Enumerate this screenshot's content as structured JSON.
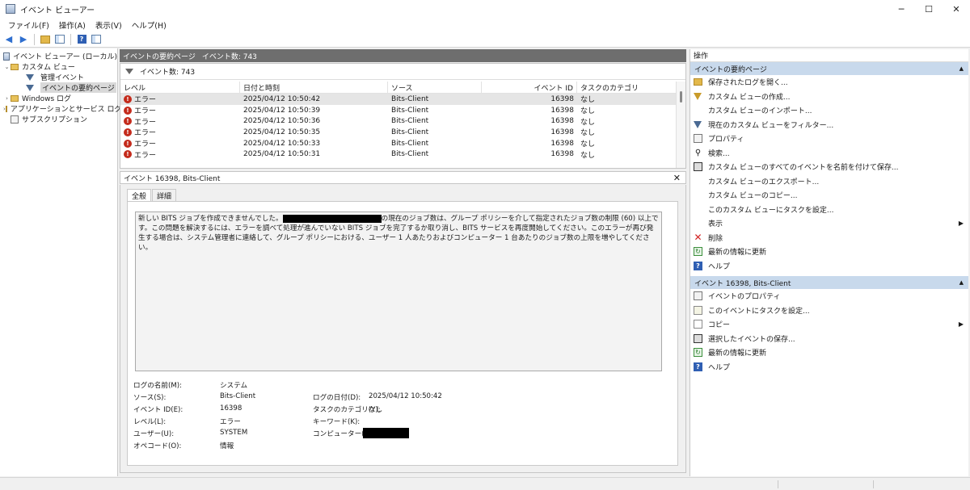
{
  "window": {
    "title": "イベント ビューアー",
    "controls": [
      "─",
      "☐",
      "✕"
    ]
  },
  "menu": [
    "ファイル(F)",
    "操作(A)",
    "表示(V)",
    "ヘルプ(H)"
  ],
  "tree": {
    "items": [
      {
        "label": "イベント ビューアー (ローカル)",
        "expander": "",
        "level": 0
      },
      {
        "label": "カスタム ビュー",
        "expander": "⌄",
        "level": 1
      },
      {
        "label": "管理イベント",
        "expander": "",
        "level": 2
      },
      {
        "label": "イベントの要約ページ",
        "expander": "",
        "level": 2
      },
      {
        "label": "Windows ログ",
        "expander": "›",
        "level": 1
      },
      {
        "label": "アプリケーションとサービス ログ",
        "expander": "›",
        "level": 1
      },
      {
        "label": "サブスクリプション",
        "expander": "",
        "level": 1
      }
    ]
  },
  "center": {
    "header_title": "イベントの要約ページ",
    "header_count": "イベント数: 743",
    "filter_text": "イベント数: 743",
    "columns": [
      "レベル",
      "日付と時刻",
      "ソース",
      "イベント ID",
      "タスクのカテゴリ"
    ],
    "rows": [
      {
        "level": "エラー",
        "datetime": "2025/04/12 10:50:42",
        "source": "Bits-Client",
        "id": "16398",
        "category": "なし"
      },
      {
        "level": "エラー",
        "datetime": "2025/04/12 10:50:39",
        "source": "Bits-Client",
        "id": "16398",
        "category": "なし"
      },
      {
        "level": "エラー",
        "datetime": "2025/04/12 10:50:36",
        "source": "Bits-Client",
        "id": "16398",
        "category": "なし"
      },
      {
        "level": "エラー",
        "datetime": "2025/04/12 10:50:35",
        "source": "Bits-Client",
        "id": "16398",
        "category": "なし"
      },
      {
        "level": "エラー",
        "datetime": "2025/04/12 10:50:33",
        "source": "Bits-Client",
        "id": "16398",
        "category": "なし"
      },
      {
        "level": "エラー",
        "datetime": "2025/04/12 10:50:31",
        "source": "Bits-Client",
        "id": "16398",
        "category": "なし"
      }
    ]
  },
  "detail": {
    "title": "イベント 16398, Bits-Client",
    "close": "✕",
    "tabs": [
      "全般",
      "詳細"
    ],
    "message_part1": "新しい BITS ジョブを作成できませんでした。",
    "message_part2": "の現在のジョブ数は、グループ ポリシーを介して指定されたジョブ数の制限 (60) 以上です。この問題を解決するには、エラーを調べて処理が進んでいない BITS ジョブを完了するか取り消し、BITS サービスを再度開始してください。このエラーが再び発生する場合は、システム管理者に連絡して、グループ ポリシーにおける、ユーザー 1 人あたりおよびコンピューター 1 台あたりのジョブ数の上限を増やしてください。",
    "props": {
      "log_name_label": "ログの名前(M):",
      "log_name": "システム",
      "source_label": "ソース(S):",
      "source": "Bits-Client",
      "logged_label": "ログの日付(D):",
      "logged": "2025/04/12 10:50:42",
      "event_id_label": "イベント ID(E):",
      "event_id": "16398",
      "task_label": "タスクのカテゴリ(Y):",
      "task": "なし",
      "level_label": "レベル(L):",
      "level": "エラー",
      "keywords_label": "キーワード(K):",
      "user_label": "ユーザー(U):",
      "user": "SYSTEM",
      "computer_label": "コンピューター(R):",
      "opcode_label": "オペコード(O):",
      "opcode": "情報"
    }
  },
  "actions": {
    "title": "操作",
    "section1": "イベントの要約ページ",
    "section1_items": [
      {
        "label": "保存されたログを開く...",
        "icon": "open-folder-icon"
      },
      {
        "label": "カスタム ビューの作成...",
        "icon": "filter-icon"
      },
      {
        "label": "カスタム ビューのインポート...",
        "icon": ""
      },
      {
        "label": "現在のカスタム ビューをフィルター...",
        "icon": "filter-icon"
      },
      {
        "label": "プロパティ",
        "icon": "properties-icon"
      },
      {
        "label": "検索...",
        "icon": "find-icon"
      },
      {
        "label": "カスタム ビューのすべてのイベントを名前を付けて保存...",
        "icon": "save-icon"
      },
      {
        "label": "カスタム ビューのエクスポート...",
        "icon": ""
      },
      {
        "label": "カスタム ビューのコピー...",
        "icon": ""
      },
      {
        "label": "このカスタム ビューにタスクを設定...",
        "icon": ""
      },
      {
        "label": "表示",
        "icon": "",
        "submenu": true
      },
      {
        "label": "削除",
        "icon": "delete-icon"
      },
      {
        "label": "最新の情報に更新",
        "icon": "refresh-icon"
      },
      {
        "label": "ヘルプ",
        "icon": "help-icon"
      }
    ],
    "section2": "イベント 16398, Bits-Client",
    "section2_items": [
      {
        "label": "イベントのプロパティ",
        "icon": "properties-icon"
      },
      {
        "label": "このイベントにタスクを設定...",
        "icon": "task-icon"
      },
      {
        "label": "コピー",
        "icon": "copy-icon",
        "submenu": true
      },
      {
        "label": "選択したイベントの保存...",
        "icon": "save-icon"
      },
      {
        "label": "最新の情報に更新",
        "icon": "refresh-icon"
      },
      {
        "label": "ヘルプ",
        "icon": "help-icon"
      }
    ]
  }
}
